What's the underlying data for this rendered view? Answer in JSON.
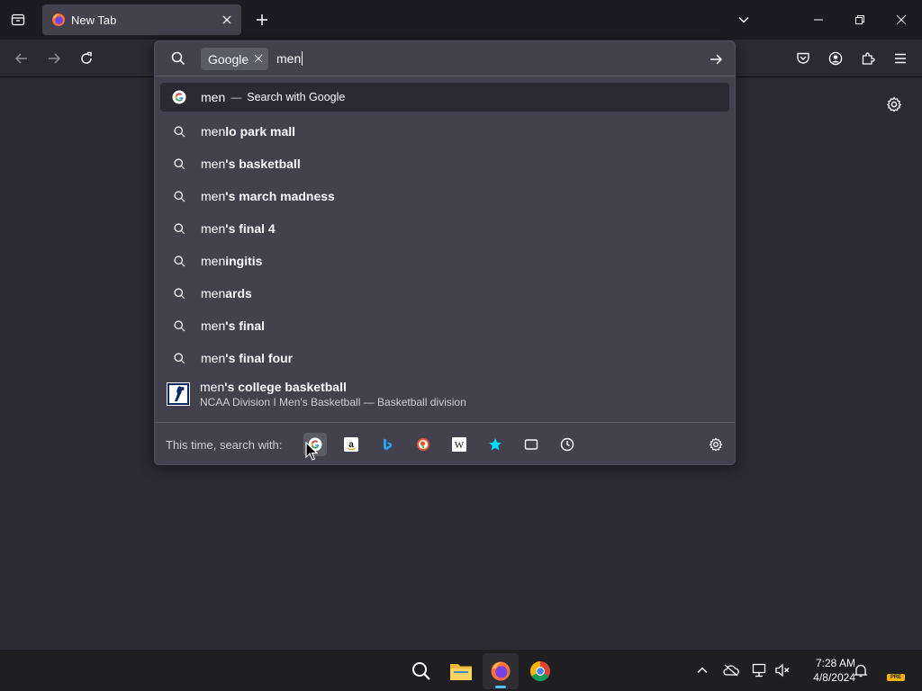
{
  "tabstrip": {
    "tab_title": "New Tab"
  },
  "urlbar": {
    "engine_chip": "Google",
    "typed_text": "men",
    "heuristic": {
      "typed": "men",
      "dash": "—",
      "action": "Search with Google"
    },
    "suggestions": [
      {
        "typed": "men",
        "suffix": "lo park mall"
      },
      {
        "typed": "men",
        "suffix": "'s basketball"
      },
      {
        "typed": "men",
        "suffix": "'s march madness"
      },
      {
        "typed": "men",
        "suffix": "'s final 4"
      },
      {
        "typed": "men",
        "suffix": "ingitis"
      },
      {
        "typed": "men",
        "suffix": "ards"
      },
      {
        "typed": "men",
        "suffix": "'s final"
      },
      {
        "typed": "men",
        "suffix": "'s final four"
      }
    ],
    "rich": {
      "typed": "men",
      "suffix": "'s college basketball",
      "description": "NCAA Division I Men's Basketball — Basketball division"
    },
    "oneoff_label": "This time, search with:",
    "oneoff_engines": [
      "google-icon",
      "amazon-icon",
      "bing-icon",
      "duckduckgo-icon",
      "wikipedia-icon",
      "bookmarks-icon",
      "tabs-icon",
      "history-icon"
    ]
  },
  "taskbar": {
    "time": "7:28 AM",
    "date": "4/8/2024",
    "badge": "PRE"
  },
  "colors": {
    "toolbar": "#2b2a33",
    "popup": "#42414d",
    "accent": "#4cc2ff"
  }
}
